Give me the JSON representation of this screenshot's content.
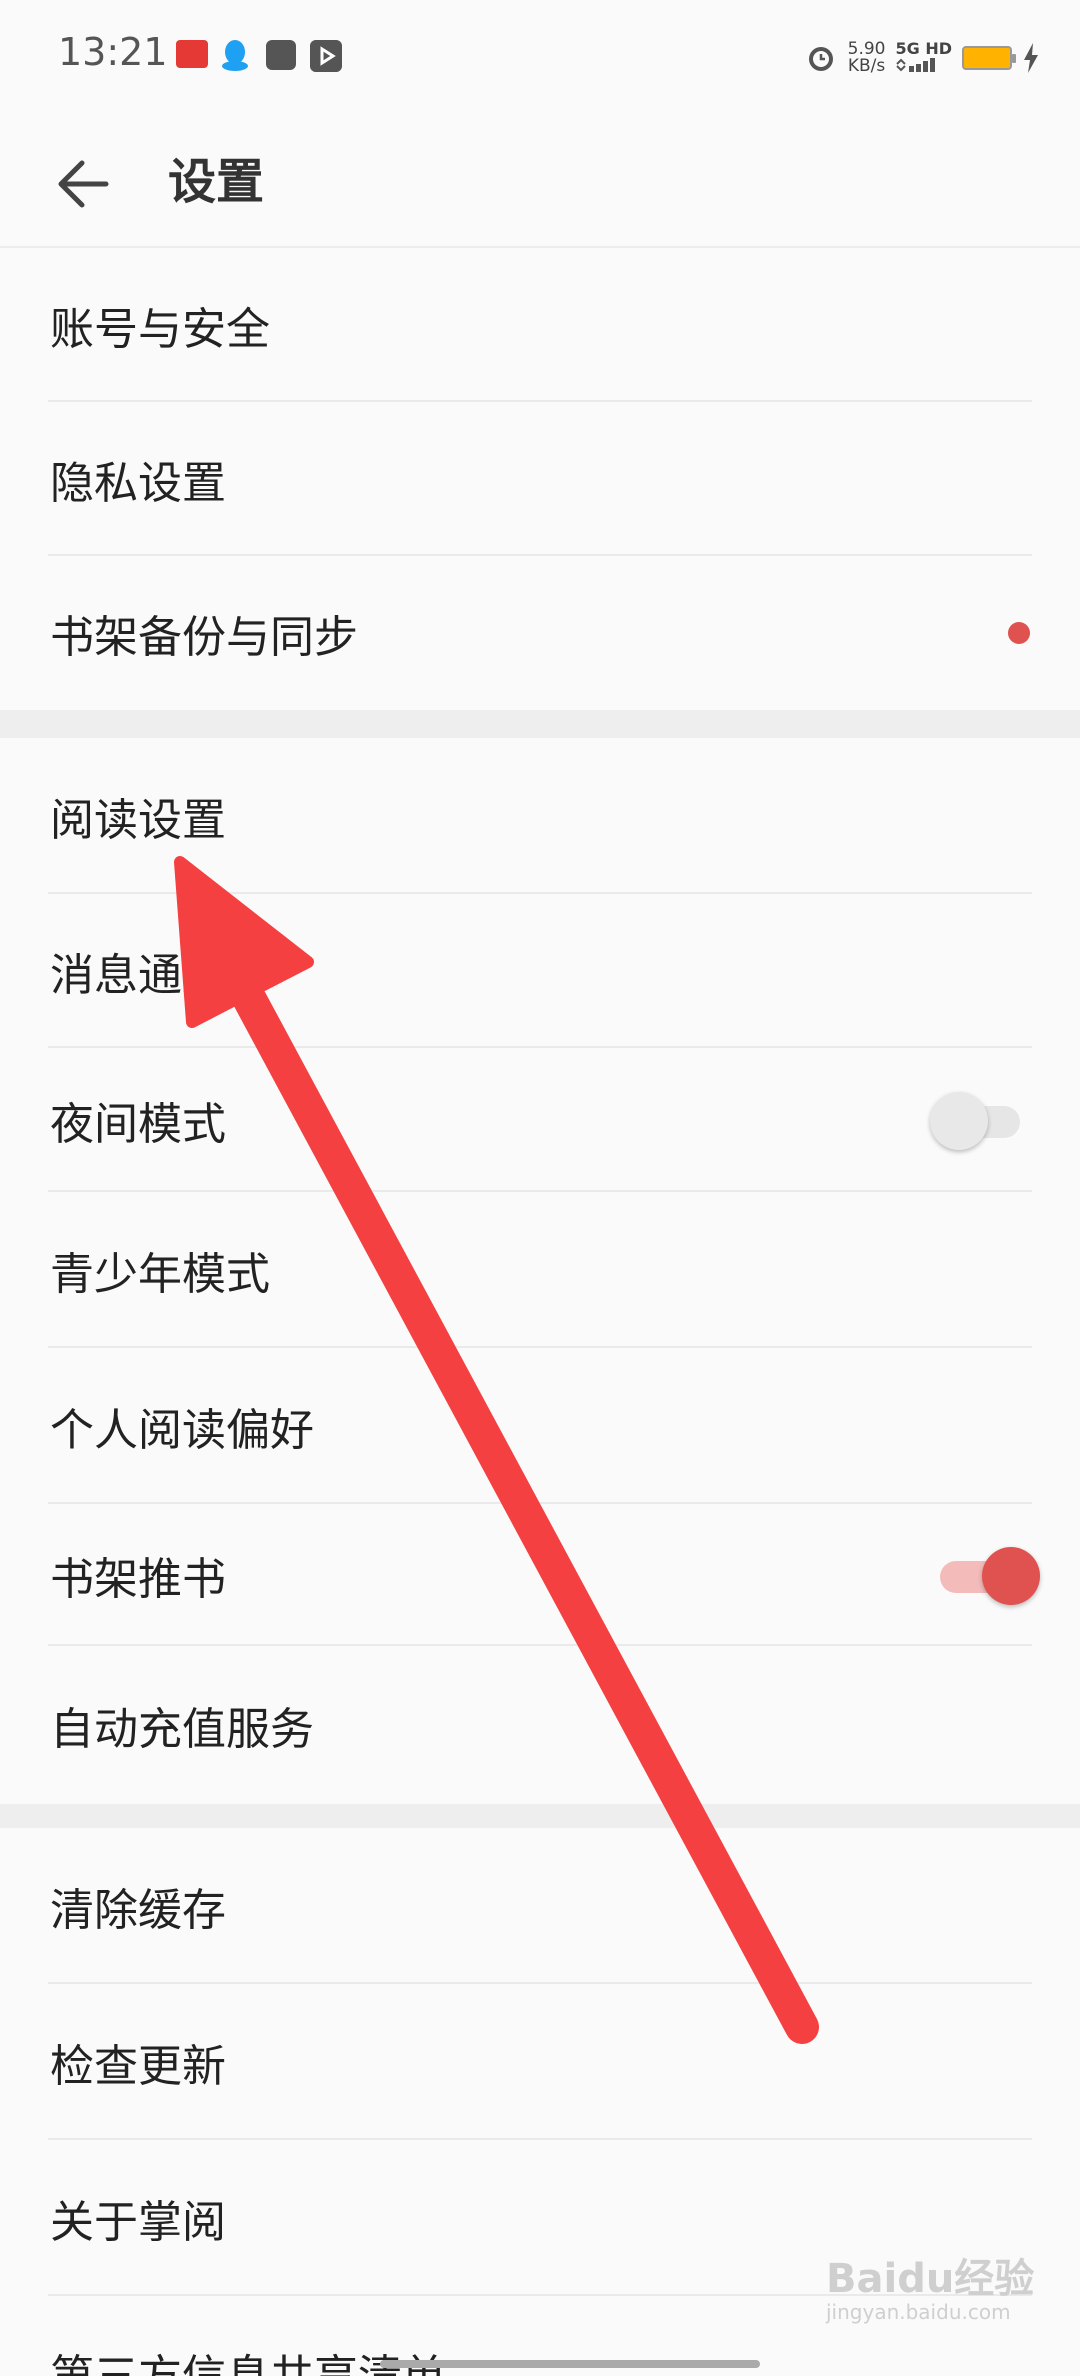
{
  "status_bar": {
    "time": "13:21",
    "speed_value": "5.90",
    "speed_unit": "KB/s",
    "network": "5G HD",
    "icons": [
      "news-icon",
      "qq-icon",
      "card-icon",
      "play-icon",
      "alarm-icon",
      "signal-icon",
      "battery-icon",
      "charging-icon"
    ]
  },
  "header": {
    "title": "设置",
    "back_icon": "arrow-left-icon"
  },
  "groups": [
    {
      "items": [
        "账号与安全",
        "隐私设置",
        "书架备份与同步"
      ]
    },
    {
      "items": [
        "阅读设置",
        "消息通知",
        "夜间模式",
        "青少年模式",
        "个人阅读偏好",
        "书架推书",
        "自动充值服务"
      ]
    },
    {
      "items": [
        "清除缓存",
        "检查更新",
        "关于掌阅",
        "第三方信息共享清单"
      ]
    }
  ],
  "toggles": {
    "night_mode": false,
    "bookshelf_recommend": true
  },
  "colors": {
    "accent": "#e0524f",
    "annotation_arrow": "#f44040",
    "background": "#fafafa"
  },
  "watermark": {
    "brand": "Baidu经验",
    "domain": "jingyan.baidu.com"
  }
}
